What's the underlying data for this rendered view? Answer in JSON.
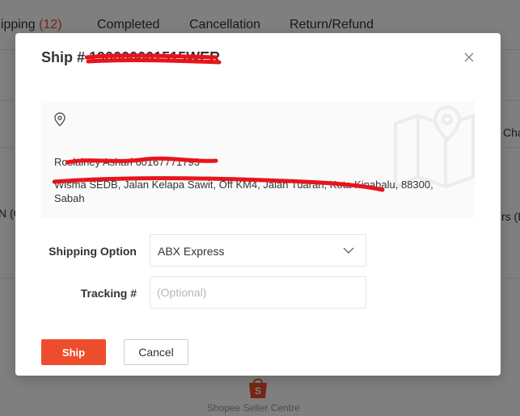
{
  "background": {
    "tabs": [
      {
        "label": "hipping",
        "count": "(12)"
      },
      {
        "label": "Completed"
      },
      {
        "label": "Cancellation"
      },
      {
        "label": "Return/Refund"
      }
    ],
    "edge_text_right_1": "Cha",
    "edge_text_left": "N (C",
    "edge_text_right_2": "rs (E",
    "footer_text": "Shopee Seller Centre"
  },
  "modal": {
    "title_prefix": "Ship #",
    "order_id": "190000001515WER",
    "address": {
      "name": "Roslainey Ashari 60167771793",
      "line": "Wisma SEDB, Jalan Kelapa Sawit, Off KM4, Jalan Tuaran, Kota Kinabalu, 88300, Sabah"
    },
    "form": {
      "shipping_option_label": "Shipping Option",
      "shipping_option_value": "ABX Express",
      "tracking_label": "Tracking #",
      "tracking_placeholder": "(Optional)"
    },
    "buttons": {
      "ship": "Ship",
      "cancel": "Cancel"
    }
  },
  "colors": {
    "accent": "#ee4d2d",
    "redaction": "#e8141a"
  }
}
